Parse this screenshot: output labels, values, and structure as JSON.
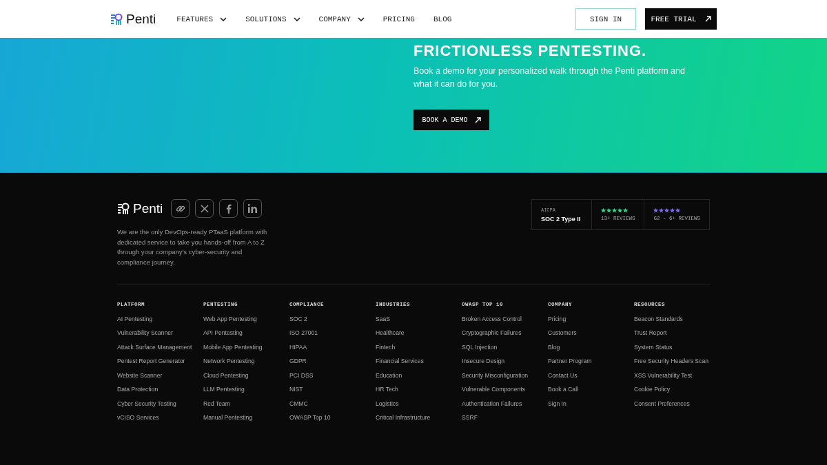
{
  "header": {
    "logo": "Penti",
    "nav": [
      {
        "label": "FEATURES",
        "kind": "dropdown"
      },
      {
        "label": "SOLUTIONS",
        "kind": "dropdown"
      },
      {
        "label": "COMPANY",
        "kind": "dropdown"
      },
      {
        "label": "PRICING",
        "kind": "link"
      },
      {
        "label": "BLOG",
        "kind": "link"
      }
    ],
    "sign_in": "SIGN IN",
    "free_trial": "FREE TRIAL"
  },
  "hero": {
    "heading": "FRICTIONLESS PENTESTING.",
    "text": "Book a demo for your personalized walk through the Penti platform and what it can do for you.",
    "button": "BOOK A DEMO"
  },
  "footer": {
    "logo": "Penti",
    "socials": [
      {
        "kind": "link"
      },
      {
        "kind": "x"
      },
      {
        "kind": "facebook"
      },
      {
        "kind": "linkedin"
      }
    ],
    "about": "We are the only DevOps-ready PTaaS platform with dedicated service to take you hands-off from A to Z through your company's cyber-security and compliance journey.",
    "badges": [
      {
        "kind": "cert",
        "label": "AICPA",
        "title": "SOC 2 Type II"
      },
      {
        "kind": "reviews",
        "stars": 5,
        "color": "#2fd48a",
        "label": "13+ REVIEWS"
      },
      {
        "kind": "reviews",
        "stars": 5,
        "color": "#7b6cf0",
        "label": "G2 - 6+ REVIEWS"
      }
    ],
    "columns": [
      {
        "title": "PLATFORM",
        "links": [
          "AI Pentesting",
          "Vulnerability Scanner",
          "Attack Surface Management",
          "Pentest Report Generator",
          "Website Scanner",
          "Data Protection",
          "Cyber Security Testing",
          "vCISO Services"
        ]
      },
      {
        "title": "PENTESTING",
        "links": [
          "Web App Pentesting",
          "API Pentesting",
          "Mobile App Pentesting",
          "Network Pentesting",
          "Cloud Pentesting",
          "LLM Pentesting",
          "Red Team",
          "Manual Pentesting"
        ]
      },
      {
        "title": "COMPLIANCE",
        "links": [
          "SOC 2",
          "ISO 27001",
          "HIPAA",
          "GDPR",
          "PCI DSS",
          "NIST",
          "CMMC",
          "OWASP Top 10"
        ]
      },
      {
        "title": "INDUSTRIES",
        "links": [
          "SaaS",
          "Healthcare",
          "Fintech",
          "Financial Services",
          "Education",
          "HR Tech",
          "Logistics",
          "Critical Infrastructure"
        ]
      },
      {
        "title": "OWASP TOP 10",
        "links": [
          "Broken Access Control",
          "Cryptographic Failures",
          "SQL Injection",
          "Insecure Design",
          "Security Misconfiguration",
          "Vulnerable Components",
          "Authentication Failures",
          "SSRF"
        ]
      },
      {
        "title": "COMPANY",
        "links": [
          "Pricing",
          "Customers",
          "Blog",
          "Partner Program",
          "Contact Us",
          "Book a Call",
          "Sign In"
        ]
      },
      {
        "title": "RESOURCES",
        "links": [
          "Beacon Standards",
          "Trust Report",
          "System Status",
          "Free Security Headers Scan",
          "XSS Vulnerability Test",
          "Cookie Policy",
          "Consent Preferences"
        ]
      }
    ]
  }
}
